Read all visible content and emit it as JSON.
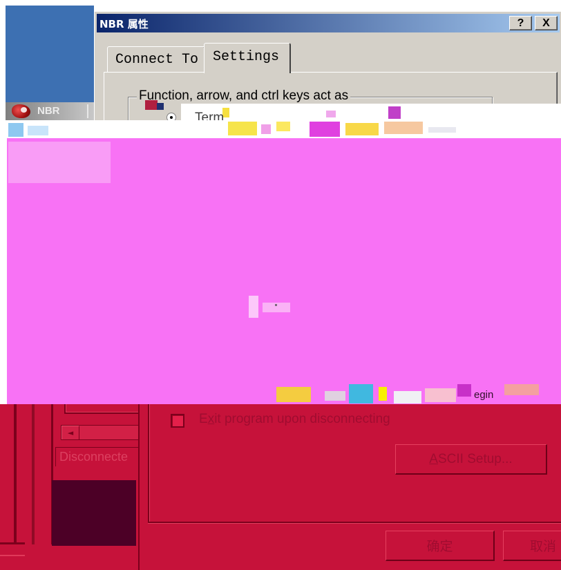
{
  "colors": {
    "desktop_blue": "#3d70b2",
    "dialog_face": "#d4d0c8",
    "title_gradient_start": "#0a246a",
    "title_gradient_end": "#a6caf0",
    "glitch_magenta": "#f872f5",
    "tint_red": "#c6123a",
    "tint_dark": "#7c001c",
    "tint_text": "#a00c30",
    "tint_maroon": "#4c0026"
  },
  "background_window": {
    "title": "NBR",
    "icon": "nbr-app-icon",
    "scroll_left_icon": "scroll-left-arrow-icon",
    "scroll_left_glyph": "◄",
    "status": "Disconnecte"
  },
  "dialog": {
    "title": "NBR 属性",
    "help_button": "?",
    "close_button": "X",
    "tabs": [
      {
        "label": "Connect To",
        "selected": false
      },
      {
        "label": "Settings",
        "selected": true
      }
    ],
    "settings": {
      "keys_group": {
        "label": "Function, arrow, and ctrl keys act as",
        "terminal_option": {
          "label_key": "T",
          "label_rest": "erm",
          "selected": true
        }
      },
      "exit_on_disconnect": {
        "label_pre": "E",
        "label_key": "x",
        "label_post": "it program upon disconnecting",
        "checked": false
      },
      "ascii_setup": {
        "label_key": "A",
        "label_rest": "SCII Setup..."
      }
    },
    "ok_button": "确定",
    "cancel_button": "取消"
  },
  "glitch": {
    "text_fragment": "egin"
  }
}
